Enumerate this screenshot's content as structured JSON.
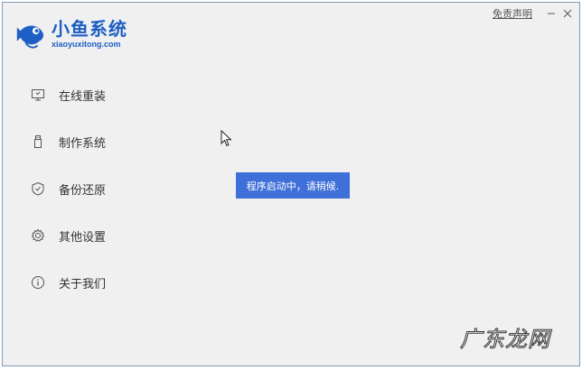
{
  "app": {
    "title": "小鱼系统",
    "subtitle": "xiaoyuxitong.com"
  },
  "titlebar": {
    "disclaimer": "免责声明",
    "minimize_icon": "minimize-icon",
    "close_icon": "close-icon"
  },
  "menu": [
    {
      "label": "在线重装",
      "icon": "monitor-icon"
    },
    {
      "label": "制作系统",
      "icon": "usb-icon"
    },
    {
      "label": "备份还原",
      "icon": "backup-icon"
    },
    {
      "label": "其他设置",
      "icon": "gear-icon"
    },
    {
      "label": "关于我们",
      "icon": "info-icon"
    }
  ],
  "toast": {
    "message": "程序启动中，请稍候."
  },
  "watermark": "广东龙网",
  "colors": {
    "accent": "#1d5fc4",
    "toast_bg": "#3f6fd8",
    "window_bg": "#f0f0f0"
  }
}
